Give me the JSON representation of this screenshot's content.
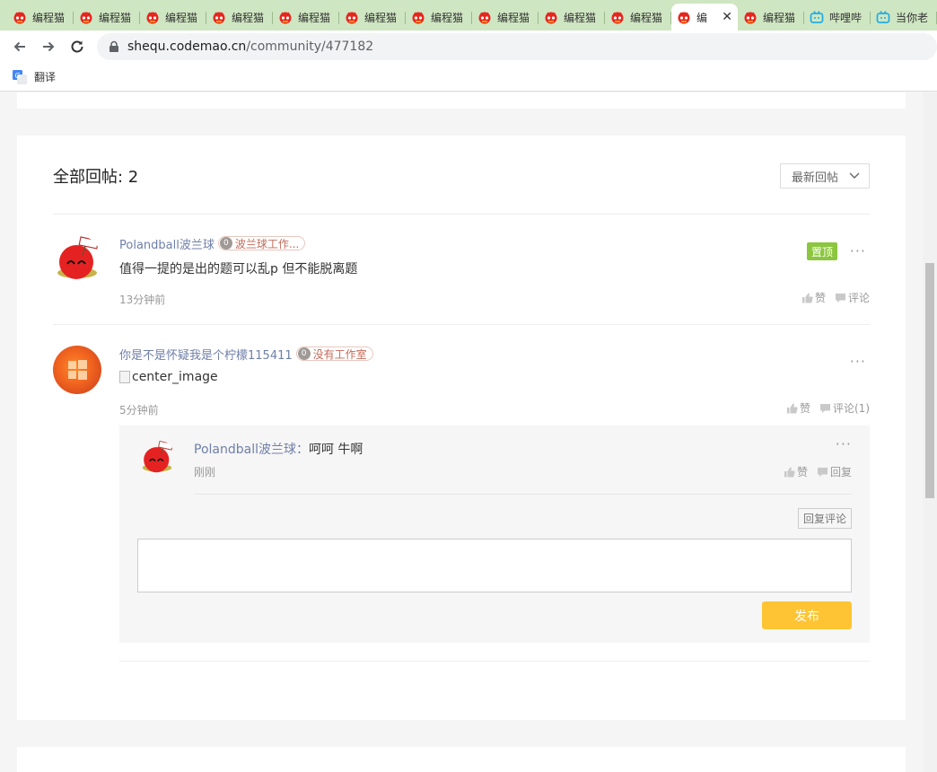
{
  "browser": {
    "tabs": [
      {
        "title": "编程猫",
        "icon": "codemao-icon",
        "active": false
      },
      {
        "title": "编程猫",
        "icon": "codemao-icon",
        "active": false
      },
      {
        "title": "编程猫",
        "icon": "codemao-icon",
        "active": false
      },
      {
        "title": "编程猫",
        "icon": "codemao-icon",
        "active": false
      },
      {
        "title": "编程猫",
        "icon": "codemao-icon",
        "active": false
      },
      {
        "title": "编程猫",
        "icon": "codemao-icon",
        "active": false
      },
      {
        "title": "编程猫",
        "icon": "codemao-icon",
        "active": false
      },
      {
        "title": "编程猫",
        "icon": "codemao-icon",
        "active": false
      },
      {
        "title": "编程猫",
        "icon": "codemao-icon",
        "active": false
      },
      {
        "title": "编程猫",
        "icon": "codemao-icon",
        "active": false
      },
      {
        "title": "编",
        "icon": "codemao-icon",
        "active": true
      },
      {
        "title": "编程猫",
        "icon": "codemao-icon",
        "active": false
      },
      {
        "title": "哔哩哔",
        "icon": "bilibili-icon",
        "active": false
      },
      {
        "title": "当你老",
        "icon": "bilibili-icon",
        "active": false
      }
    ],
    "close_glyph": "✕",
    "url_host": "shequ.codemao.cn",
    "url_path": "/community/477182",
    "bookmark_translate": "翻译",
    "colors": {
      "tabbar": "#cfe6c2",
      "accent": "#fec433",
      "pin": "#8cc63f"
    }
  },
  "replies": {
    "count_label": "全部回帖: 2",
    "sort_label": "最新回帖",
    "posts": [
      {
        "author": "Polandball波兰球",
        "studio_level": "0",
        "studio": "波兰球工作...",
        "text": "值得一提的是出的题可以乱p 但不能脱离题",
        "pin_label": "置顶",
        "time": "13分钟前",
        "like_label": "赞",
        "comment_label": "评论",
        "more": "···"
      },
      {
        "author": "你是不是怀疑我是个柠檬115411",
        "studio_level": "0",
        "studio": "没有工作室",
        "image_alt": "center_image",
        "time": "5分钟前",
        "like_label": "赞",
        "comment_label": "评论(1)",
        "more": "···",
        "comments": [
          {
            "author": "Polandball波兰球",
            "separator": "：",
            "text": "呵呵 牛啊",
            "time": "刚刚",
            "like_label": "赞",
            "reply_label": "回复",
            "more": "···"
          }
        ],
        "reply_comment_label": "回复评论",
        "input_placeholder": "",
        "publish_label": "发布"
      }
    ]
  }
}
